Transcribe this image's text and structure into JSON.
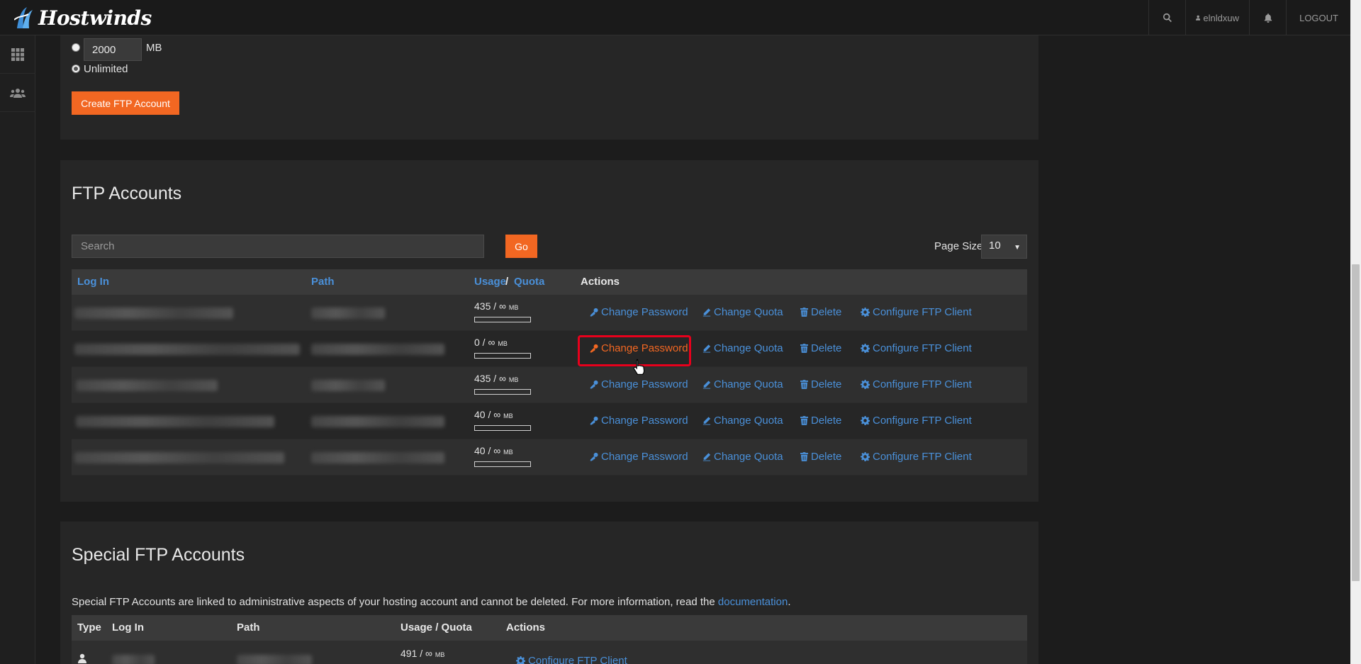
{
  "header": {
    "logo_text": "Hostwinds",
    "username": "elnldxuw",
    "logout": "LOGOUT"
  },
  "create_form": {
    "quota_value": "2000",
    "quota_unit": "MB",
    "unlimited_label": "Unlimited",
    "create_button": "Create FTP Account"
  },
  "ftp_accounts": {
    "title": "FTP Accounts",
    "search_placeholder": "Search",
    "go_button": "Go",
    "page_size_label": "Page Size",
    "page_size_value": "10",
    "columns": {
      "login": "Log In",
      "path": "Path",
      "usage": "Usage",
      "slash": "/",
      "quota": "Quota",
      "actions": "Actions"
    },
    "rows": [
      {
        "usage": "435 / ∞",
        "unit": "MB"
      },
      {
        "usage": "0 / ∞",
        "unit": "MB"
      },
      {
        "usage": "435 / ∞",
        "unit": "MB"
      },
      {
        "usage": "40 / ∞",
        "unit": "MB"
      },
      {
        "usage": "40 / ∞",
        "unit": "MB"
      }
    ],
    "actions": {
      "change_password": "Change Password",
      "change_quota": "Change Quota",
      "delete": "Delete",
      "configure": "Configure FTP Client"
    }
  },
  "special_ftp": {
    "title": "Special FTP Accounts",
    "description": "Special FTP Accounts are linked to administrative aspects of your hosting account and cannot be deleted. For more information, read the",
    "doc_link": "documentation",
    "period": ".",
    "columns": {
      "type": "Type",
      "login": "Log In",
      "path": "Path",
      "usage_quota": "Usage / Quota",
      "actions": "Actions"
    },
    "row": {
      "usage": "491 / ∞",
      "unit": "MB",
      "action": "Configure FTP Client"
    }
  },
  "colors": {
    "accent_orange": "#f26722",
    "link_blue": "#4a90d9",
    "highlight_red": "#e8001c"
  }
}
